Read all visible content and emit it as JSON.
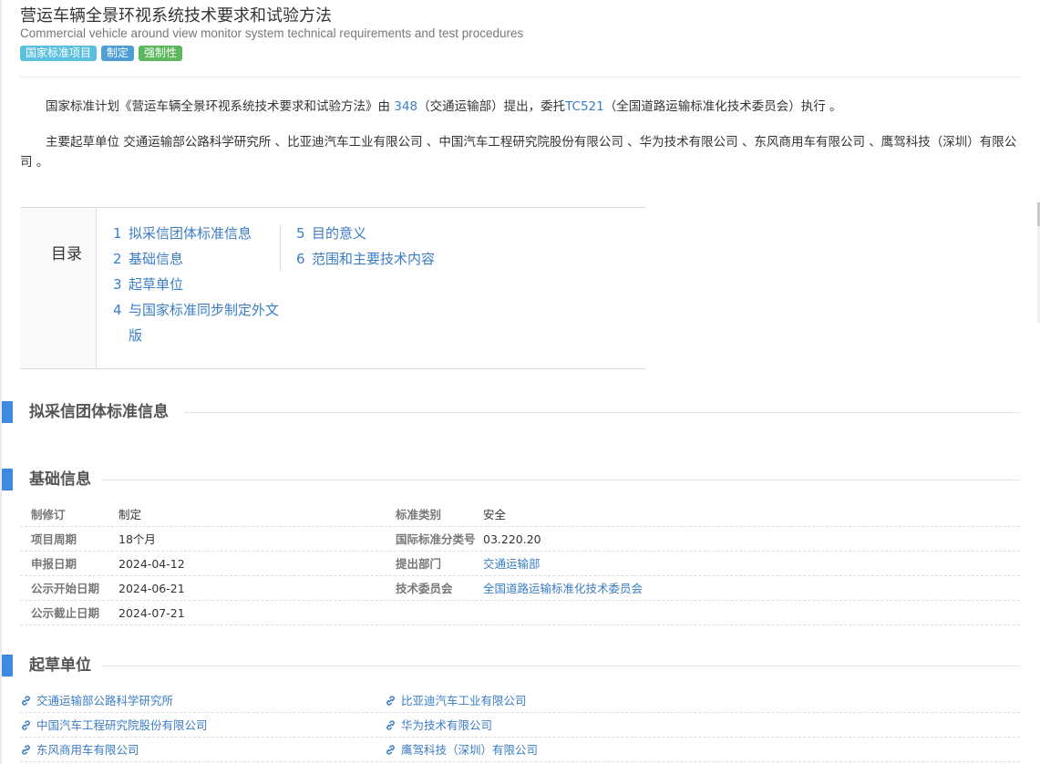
{
  "header": {
    "title": "营运车辆全景环视系统技术要求和试验方法",
    "subtitle": "Commercial vehicle around view monitor system technical requirements and test procedures",
    "badges": [
      "国家标准项目",
      "制定",
      "强制性"
    ]
  },
  "paragraphs": {
    "p1": {
      "prefix": "国家标准计划《营运车辆全景环视系统技术要求和试验方法》由 ",
      "dept_code": "348",
      "middle": "（交通运输部）提出，委托",
      "tc_code": "TC521",
      "suffix": "（全国道路运输标准化技术委员会）执行 。"
    },
    "p2": "主要起草单位 交通运输部公路科学研究所 、比亚迪汽车工业有限公司 、中国汽车工程研究院股份有限公司 、华为技术有限公司 、东风商用车有限公司 、鹰驾科技（深圳）有限公司 。"
  },
  "toc": {
    "label": "目录",
    "items": [
      {
        "num": "1",
        "text": "拟采信团体标准信息"
      },
      {
        "num": "2",
        "text": "基础信息"
      },
      {
        "num": "3",
        "text": "起草单位"
      },
      {
        "num": "4",
        "text": "与国家标准同步制定外文版"
      },
      {
        "num": "5",
        "text": "目的意义"
      },
      {
        "num": "6",
        "text": "范围和主要技术内容"
      }
    ]
  },
  "sections": {
    "s1": "拟采信团体标准信息",
    "s2": "基础信息",
    "s3": "起草单位"
  },
  "basic_info": {
    "rows": [
      {
        "l1": "制修订",
        "v1": "制定",
        "l2": "标准类别",
        "v2": "安全"
      },
      {
        "l1": "项目周期",
        "v1": "18个月",
        "l2": "国际标准分类号",
        "v2": "03.220.20"
      },
      {
        "l1": "申报日期",
        "v1": "2024-04-12",
        "l2": "提出部门",
        "v2": "交通运输部"
      },
      {
        "l1": "公示开始日期",
        "v1": "2024-06-21",
        "l2": "技术委员会",
        "v2": "全国道路运输标准化技术委员会"
      },
      {
        "l1": "公示截止日期",
        "v1": "2024-07-21",
        "l2": "",
        "v2": ""
      }
    ]
  },
  "drafting_units": [
    [
      "交通运输部公路科学研究所",
      "比亚迪汽车工业有限公司"
    ],
    [
      "中国汽车工程研究院股份有限公司",
      "华为技术有限公司"
    ],
    [
      "东风商用车有限公司",
      "鹰驾科技（深圳）有限公司"
    ]
  ],
  "colors": {
    "link": "#3a7dc5",
    "section_bar": "#3f8ae0",
    "badge_national": "#5bc0de",
    "badge_formulate": "#4e9ed8",
    "badge_mandatory": "#5cb85c"
  }
}
